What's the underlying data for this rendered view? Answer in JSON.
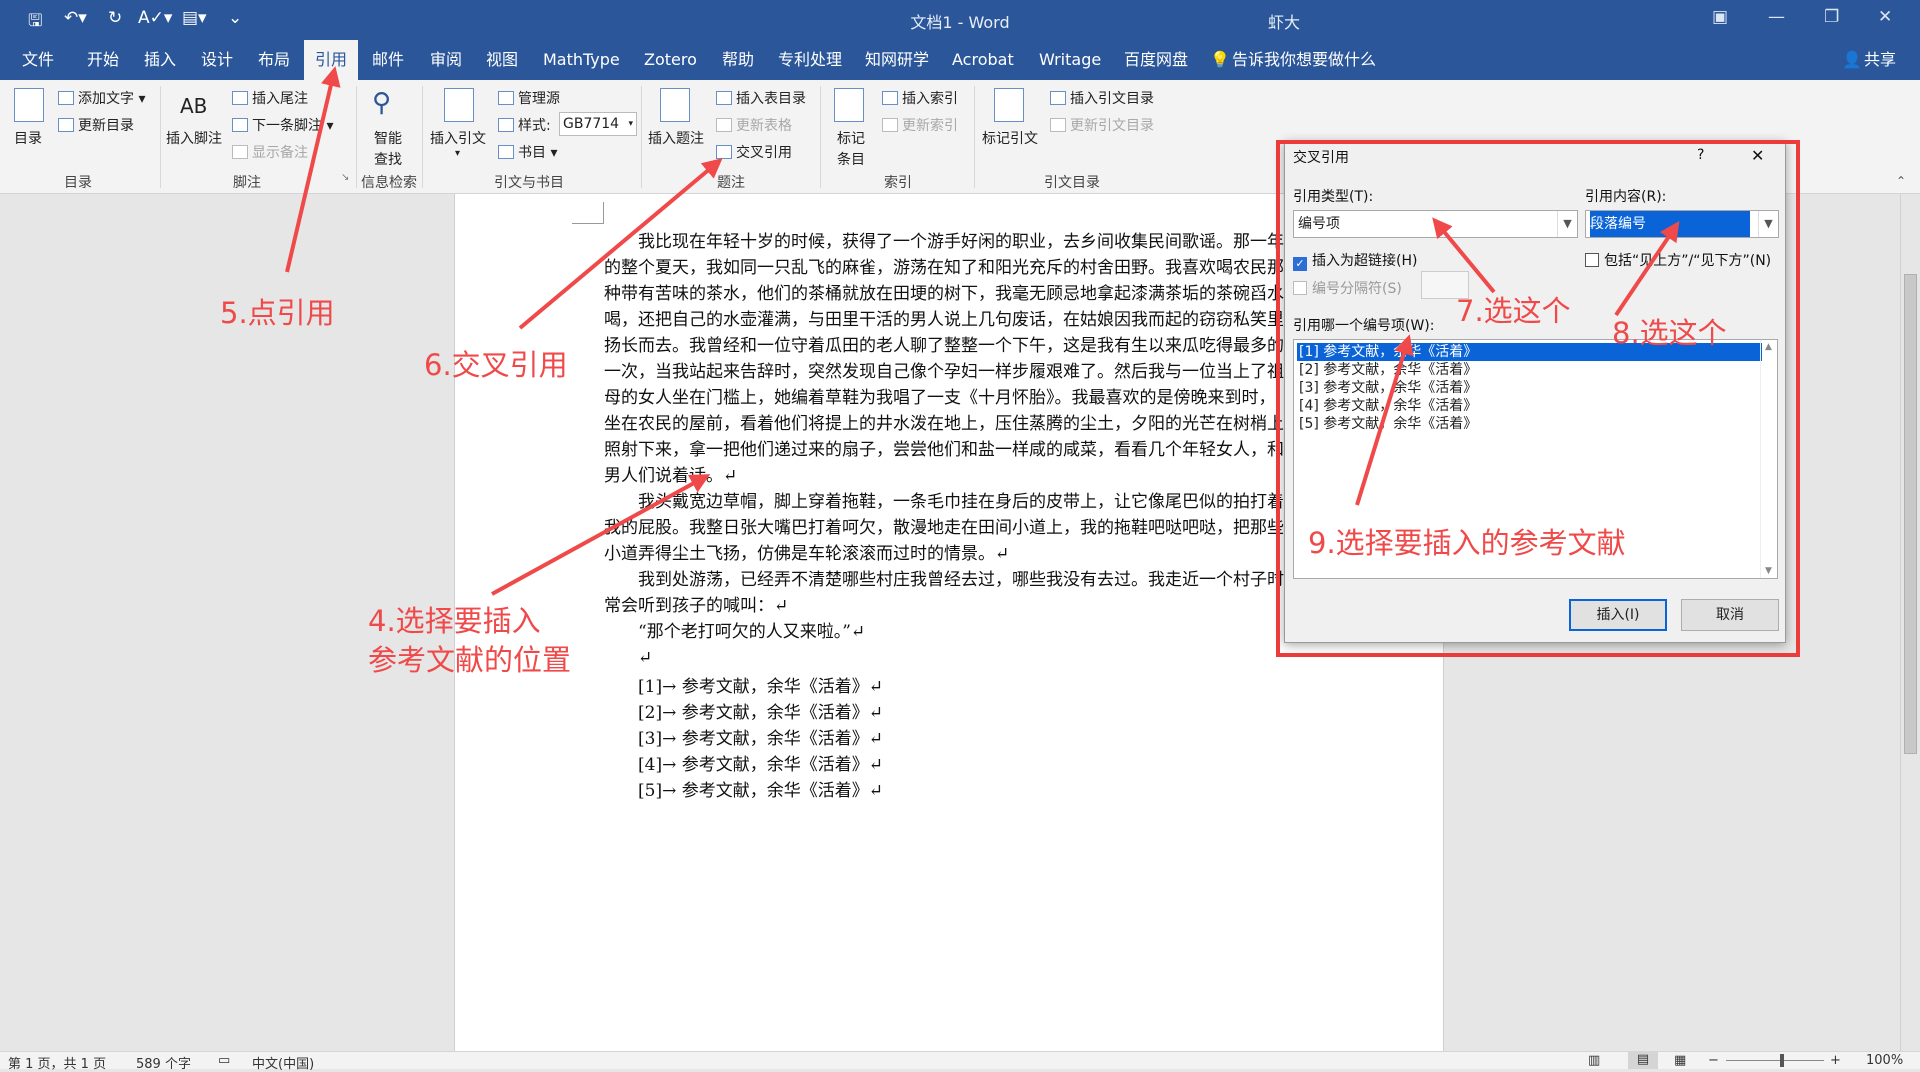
{
  "title_bar": {
    "doc_title": "文档1 - Word",
    "user": "虾大"
  },
  "menu": {
    "tabs": [
      "文件",
      "开始",
      "插入",
      "设计",
      "布局",
      "引用",
      "邮件",
      "审阅",
      "视图",
      "MathType",
      "Zotero",
      "帮助",
      "专利处理",
      "知网研学",
      "Acrobat",
      "Writage",
      "百度网盘"
    ],
    "active": "引用",
    "tell_me": "告诉我你想要做什么",
    "share": "共享"
  },
  "ribbon": {
    "toc": {
      "big": "目录",
      "add_text": "添加文字",
      "update": "更新目录",
      "group": "目录"
    },
    "footnotes": {
      "insert_footnote": "插入脚注",
      "ab": "AB",
      "insert_endnote": "插入尾注",
      "next_footnote": "下一条脚注",
      "show_notes": "显示备注",
      "group": "脚注"
    },
    "research": {
      "smart_lookup_1": "智能",
      "smart_lookup_2": "查找",
      "group": "信息检索"
    },
    "citations": {
      "insert_citation": "插入引文",
      "manage_sources": "管理源",
      "style_label": "样式:",
      "style_value": "GB7714",
      "bibliography": "书目",
      "group": "引文与书目"
    },
    "captions": {
      "insert_caption": "插入题注",
      "insert_table_figures": "插入表目录",
      "update_table": "更新表格",
      "cross_reference": "交叉引用",
      "group": "题注"
    },
    "index": {
      "mark_entry_1": "标记",
      "mark_entry_2": "条目",
      "insert_index": "插入索引",
      "update_index": "更新索引",
      "group": "索引"
    },
    "authorities": {
      "mark_citation": "标记引文",
      "insert_toa": "插入引文目录",
      "update_toa": "更新引文目录",
      "group": "引文目录"
    }
  },
  "document": {
    "para1_lines": [
      "我比现在年轻十岁的时候，获得了一个游手好闲的职业，去乡间收集民间歌谣。那一年",
      "的整个夏天，我如同一只乱飞的麻雀，游荡在知了和阳光充斥的村舍田野。我喜欢喝农民那",
      "种带有苦味的茶水，他们的茶桶就放在田埂的树下，我毫无顾忌地拿起漆满茶垢的茶碗舀水",
      "喝，还把自己的水壶灌满，与田里干活的男人说上几句废话，在姑娘因我而起的窃窃私笑里",
      "扬长而去。我曾经和一位守着瓜田的老人聊了整整一个下午，这是我有生以来瓜吃得最多的",
      "一次，当我站起来告辞时，突然发现自己像个孕妇一样步履艰难了。然后我与一位当上了祖",
      "母的女人坐在门槛上，她编着草鞋为我唱了一支《十月怀胎》。我最喜欢的是傍晚来到时，",
      "坐在农民的屋前，看着他们将提上的井水泼在地上，压住蒸腾的尘土，夕阳的光芒在树梢上",
      "照射下来，拿一把他们递过来的扇子，尝尝他们和盐一样咸的咸菜，看看几个年轻女人，和",
      "男人们说着话。↵"
    ],
    "para2_lines": [
      "我头戴宽边草帽，脚上穿着拖鞋，一条毛巾挂在身后的皮带上，让它像尾巴似的拍打着",
      "我的屁股。我整日张大嘴巴打着呵欠，散漫地走在田间小道上，我的拖鞋吧哒吧哒，把那些",
      "小道弄得尘土飞扬，仿佛是车轮滚滚而过时的情景。↵"
    ],
    "para3_lines": [
      "我到处游荡，已经弄不清楚哪些村庄我曾经去过，哪些我没有去过。我走近一个村子时，",
      "常会听到孩子的喊叫：↵"
    ],
    "quote": "“那个老打呵欠的人又来啦。”↵",
    "empty": "↵",
    "refs": [
      "[1]→ 参考文献，余华《活着》↵",
      "[2]→ 参考文献，余华《活着》↵",
      "[3]→ 参考文献，余华《活着》↵",
      "[4]→ 参考文献，余华《活着》↵",
      "[5]→ 参考文献，余华《活着》↵"
    ]
  },
  "dialog": {
    "title": "交叉引用",
    "help": "?",
    "close": "✕",
    "ref_type_label": "引用类型(T):",
    "ref_type_value": "编号项",
    "ref_content_label": "引用内容(R):",
    "ref_content_value": "段落编号",
    "hyperlink_label": "插入为超链接(H)",
    "hyperlink_checked": true,
    "include_above_below": "包括“见上方”/“见下方”(N)",
    "separator_label": "编号分隔符(S)",
    "which_label": "引用哪一个编号项(W):",
    "items": [
      "[1] 参考文献，余华《活着》",
      "[2] 参考文献，余华《活着》",
      "[3] 参考文献，余华《活着》",
      "[4] 参考文献，余华《活着》",
      "[5] 参考文献，余华《活着》"
    ],
    "selected_index": 0,
    "insert": "插入(I)",
    "cancel": "取消"
  },
  "annotations": {
    "a4_l1": "4.选择要插入",
    "a4_l2": "参考文献的位置",
    "a5": "5.点引用",
    "a6": "6.交叉引用",
    "a7": "7.选这个",
    "a8": "8.选这个",
    "a9": "9.选择要插入的参考文献",
    "color": "#f04949"
  },
  "status": {
    "page": "第 1 页，共 1 页",
    "words": "589 个字",
    "language": "中文(中国)",
    "zoom": "100%"
  }
}
